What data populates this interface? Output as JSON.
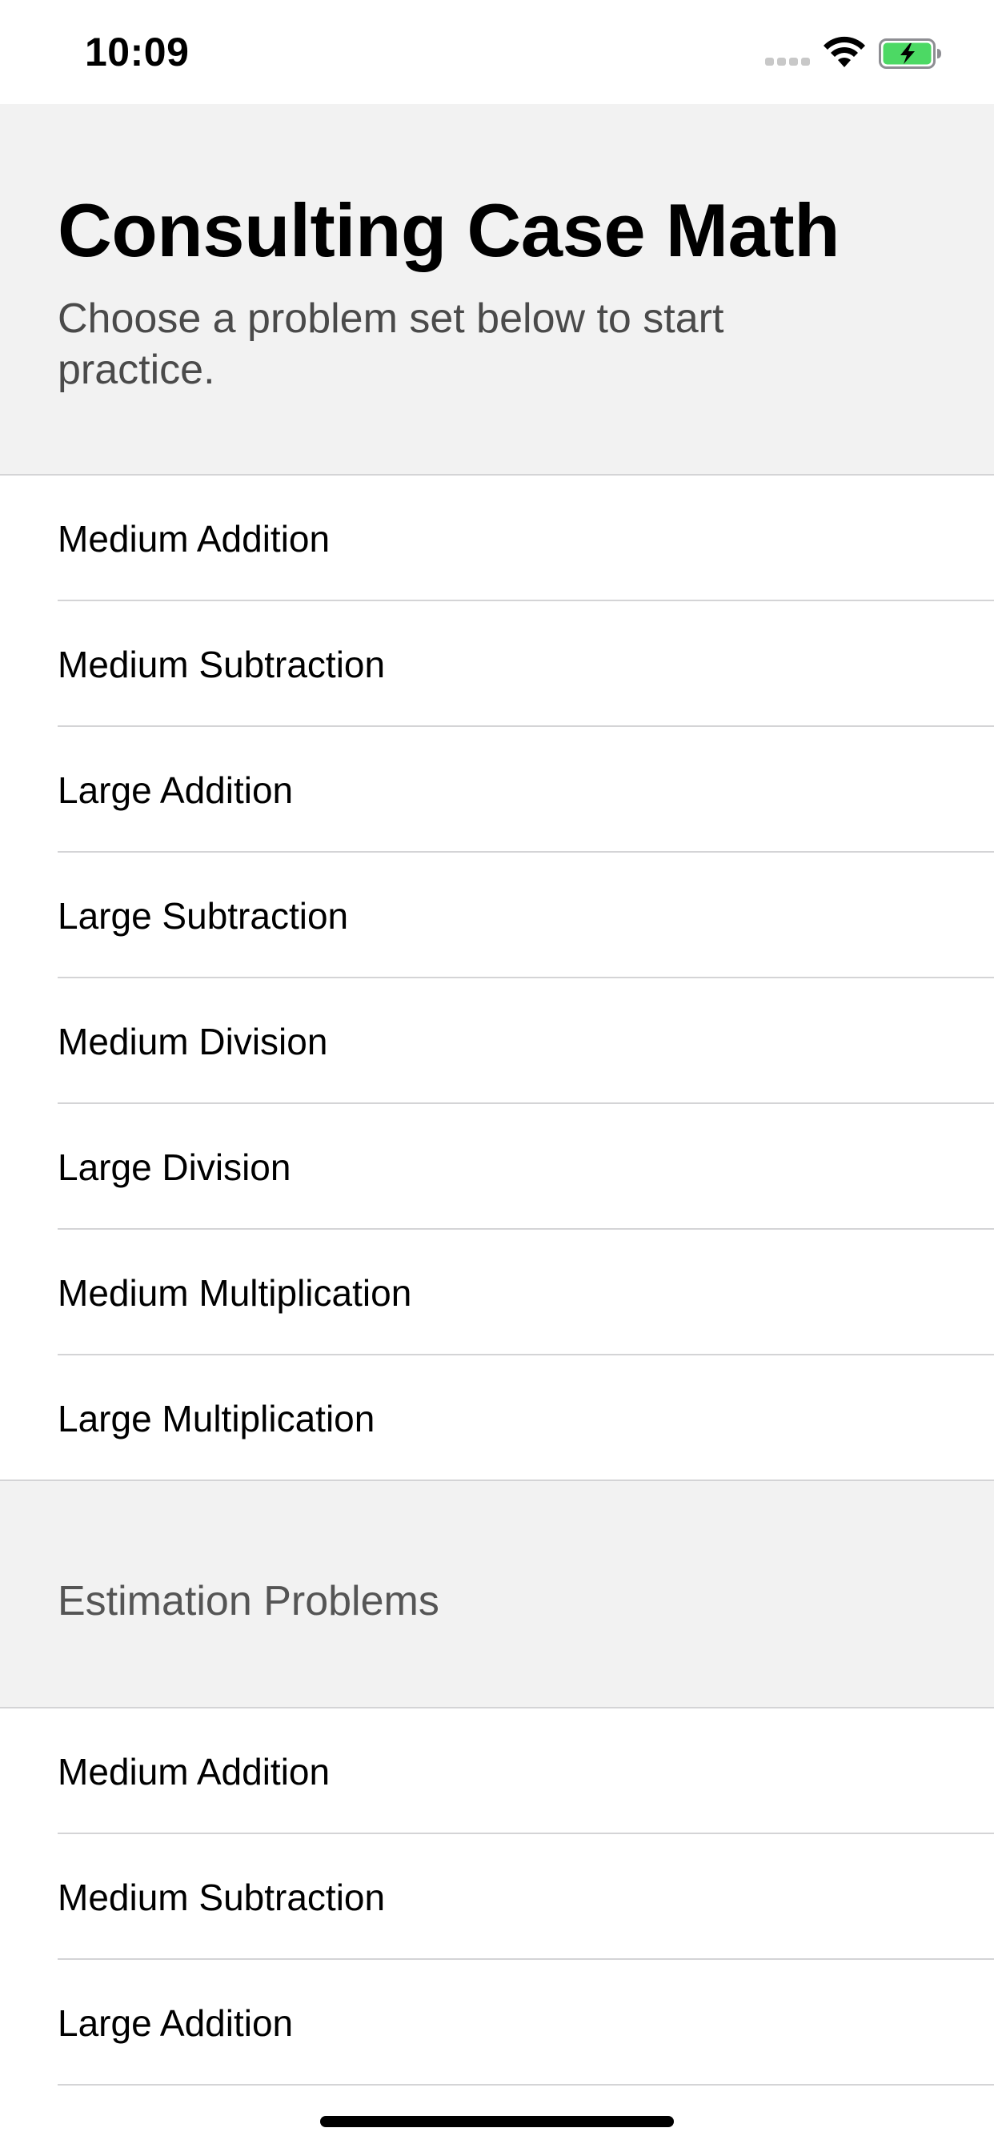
{
  "status_bar": {
    "time": "10:09",
    "signal_icon": "cellular-signal-icon",
    "wifi_icon": "wifi-icon",
    "battery_icon": "battery-charging-icon",
    "battery_color": "#4cd964"
  },
  "header": {
    "title": "Consulting Case Math",
    "subtitle": "Choose a problem set below to start practice."
  },
  "problem_sets": [
    {
      "label": "Medium Addition"
    },
    {
      "label": "Medium Subtraction"
    },
    {
      "label": "Large Addition"
    },
    {
      "label": "Large Subtraction"
    },
    {
      "label": "Medium Division"
    },
    {
      "label": "Large Division"
    },
    {
      "label": "Medium Multiplication"
    },
    {
      "label": "Large Multiplication"
    }
  ],
  "estimation_section": {
    "title": "Estimation Problems",
    "items": [
      {
        "label": "Medium Addition"
      },
      {
        "label": "Medium Subtraction"
      },
      {
        "label": "Large Addition"
      }
    ]
  },
  "colors": {
    "header_background": "#f2f2f2",
    "separator": "#d4d4d6",
    "secondary_text": "#4a4a4a"
  }
}
